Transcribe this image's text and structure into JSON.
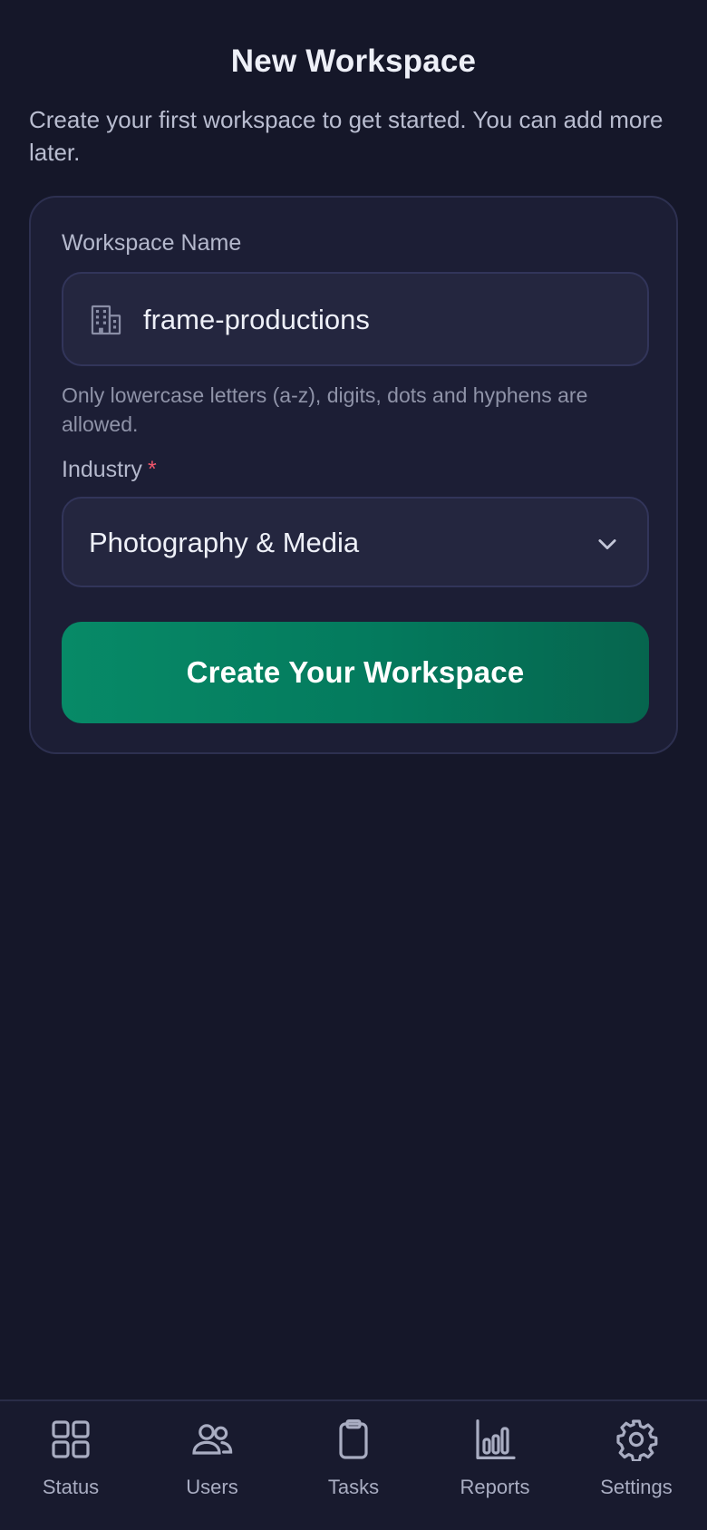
{
  "header": {
    "title": "New Workspace",
    "subtitle": "Create your first workspace to get started. You can add more later."
  },
  "form": {
    "workspace_name": {
      "label": "Workspace Name",
      "value": "frame-productions",
      "icon": "building-icon",
      "helper": "Only lowercase letters (a-z), digits, dots and hyphens are allowed."
    },
    "industry": {
      "label": "Industry",
      "required_mark": "*",
      "selected": "Photography & Media",
      "icon": "chevron-down-icon"
    },
    "submit_label": "Create Your Workspace"
  },
  "nav": {
    "items": [
      {
        "label": "Status",
        "icon": "grid-icon"
      },
      {
        "label": "Users",
        "icon": "users-icon"
      },
      {
        "label": "Tasks",
        "icon": "clipboard-icon"
      },
      {
        "label": "Reports",
        "icon": "bar-chart-icon"
      },
      {
        "label": "Settings",
        "icon": "gear-icon"
      }
    ]
  },
  "colors": {
    "background": "#151729",
    "card": "#1c1e35",
    "input": "#24263f",
    "accent": "#047a5d",
    "required": "#f0566b"
  }
}
